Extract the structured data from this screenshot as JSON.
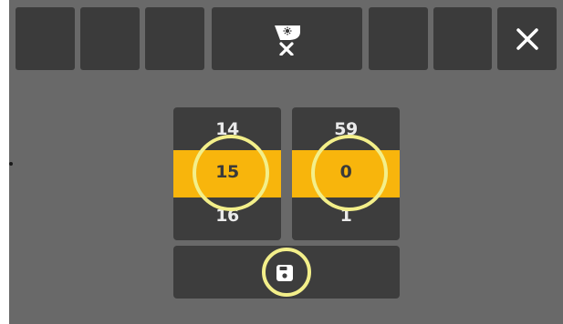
{
  "toolbar": {
    "center_icon": "wiper-off-icon",
    "close_icon": "close-icon"
  },
  "picker": {
    "hours": {
      "prev": "14",
      "current": "15",
      "next": "16"
    },
    "minutes": {
      "prev": "59",
      "current": "0",
      "next": "1"
    }
  },
  "save_icon": "save-icon",
  "colors": {
    "background": "#696969",
    "tile": "#3b3b3b",
    "accent": "#f8b50c",
    "highlight_ring": "#f3ef8a",
    "icon": "#ffffff"
  }
}
